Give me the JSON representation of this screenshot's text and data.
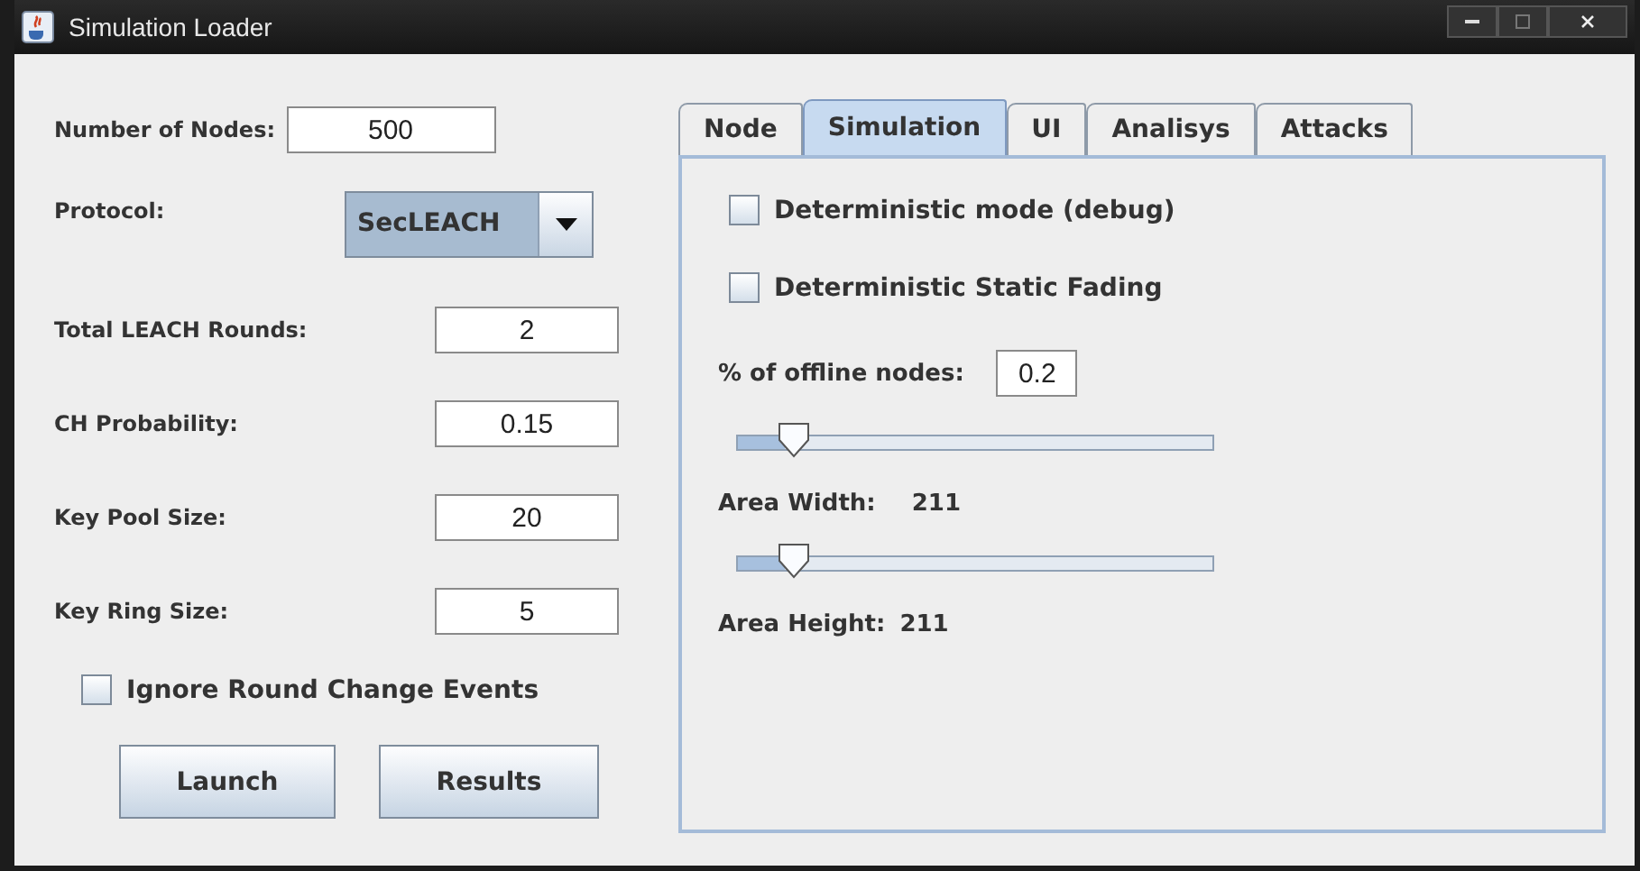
{
  "window": {
    "title": "Simulation Loader"
  },
  "left": {
    "nodes": {
      "label": "Number of Nodes:",
      "value": "500"
    },
    "protocol": {
      "label": "Protocol:",
      "value": "SecLEACH"
    },
    "fields": [
      {
        "label": "Total LEACH Rounds:",
        "value": "2"
      },
      {
        "label": "CH Probability:",
        "value": "0.15"
      },
      {
        "label": "Key Pool Size:",
        "value": "20"
      },
      {
        "label": "Key Ring Size:",
        "value": "5"
      }
    ],
    "ignore": {
      "label": "Ignore Round Change Events",
      "checked": false
    },
    "buttons": [
      "Launch",
      "Results"
    ]
  },
  "tabs": [
    {
      "label": "Node",
      "selected": false
    },
    {
      "label": "Simulation",
      "selected": true
    },
    {
      "label": "UI",
      "selected": false
    },
    {
      "label": "Analisys",
      "selected": false
    },
    {
      "label": "Attacks",
      "selected": false
    }
  ],
  "simulation": {
    "checkboxes": [
      {
        "label": "Deterministic mode (debug)",
        "checked": false
      },
      {
        "label": "Deterministic Static Fading",
        "checked": false
      }
    ],
    "offline": {
      "label": "% of offline nodes:",
      "value": "0.2"
    },
    "width_slider": {
      "level": 0.1
    },
    "width": {
      "label": "Area Width:",
      "value": "211"
    },
    "height_slider": {
      "level": 0.1
    },
    "height": {
      "label": "Area Height:",
      "value": "211"
    }
  }
}
